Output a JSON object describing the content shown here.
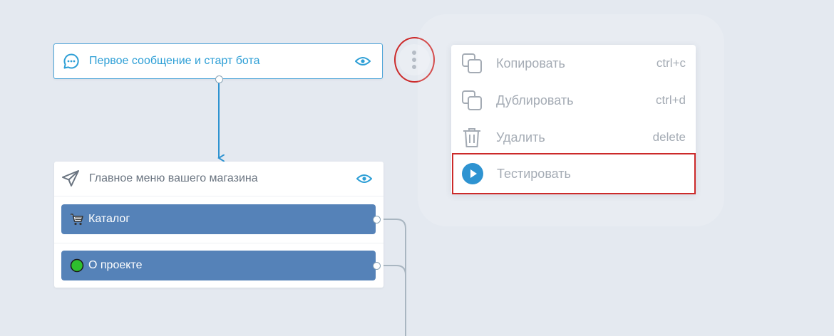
{
  "flow": {
    "start_node": {
      "title": "Первое сообщение и старт бота",
      "icon": "chat-bubble-icon",
      "preview_icon": "eye-icon"
    },
    "menu_node": {
      "title": "Главное меню вашего магазина",
      "icon": "paper-plane-icon",
      "preview_icon": "eye-icon",
      "buttons": [
        {
          "label": "Каталог",
          "icon": "shopping-cart-icon"
        },
        {
          "label": "О проекте",
          "icon": "green-circle-icon"
        }
      ]
    }
  },
  "context_menu": {
    "items": [
      {
        "label": "Копировать",
        "shortcut": "ctrl+c",
        "icon": "copy-icon"
      },
      {
        "label": "Дублировать",
        "shortcut": "ctrl+d",
        "icon": "duplicate-icon"
      },
      {
        "label": "Удалить",
        "shortcut": "delete",
        "icon": "trash-icon"
      },
      {
        "label": "Тестировать",
        "shortcut": "",
        "icon": "play-icon"
      }
    ]
  },
  "colors": {
    "canvas_bg": "#e4e9f0",
    "accent_blue": "#2e9fd6",
    "button_blue": "#5582b8",
    "highlight_red": "#cc2a2a",
    "muted_text": "#a4abb4"
  }
}
